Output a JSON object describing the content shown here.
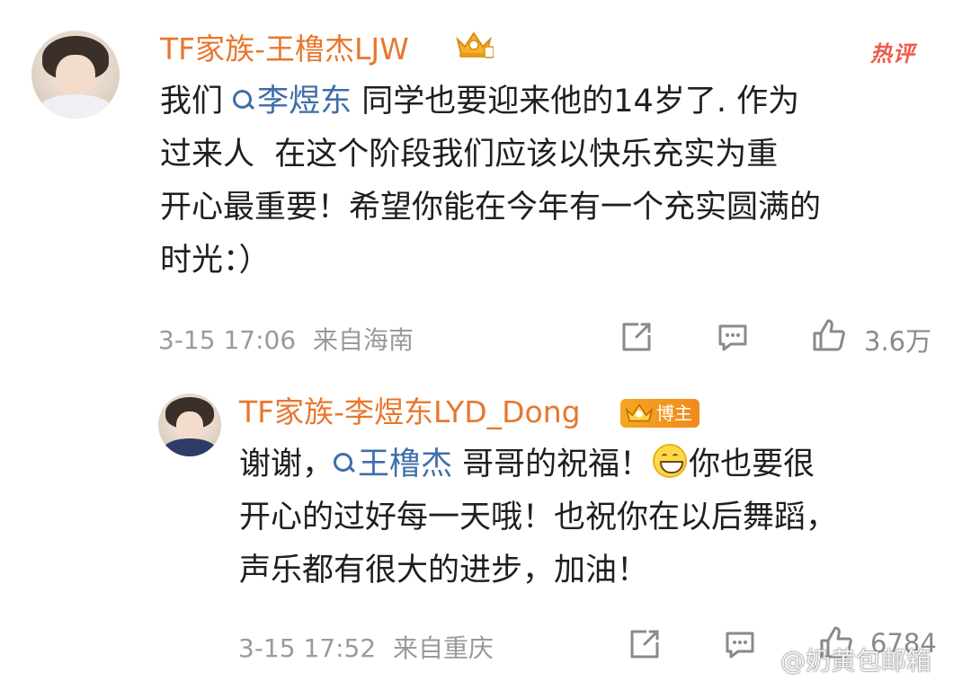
{
  "comment": {
    "username": "TF家族-王橹杰LJW",
    "hot_tag": "热评",
    "text_lines": [
      [
        "我们 ",
        "李煜东",
        " 同学也要迎来他的14岁了. 作为"
      ],
      "过来人  在这个阶段我们应该以快乐充实为重",
      "开心最重要！希望你能在今年有一个充实圆满的",
      "时光：）"
    ],
    "time": "3-15 17:06",
    "location": "来自海南",
    "likes": "3.6万"
  },
  "reply": {
    "username": "TF家族-李煜东LYD_Dong",
    "badge": "博主",
    "line1_before": "谢谢，",
    "mention": "王橹杰",
    "line1_after_mention": " 哥哥的祝福！",
    "line1_end": "你也要很",
    "line2": "开心的过好每一天哦！也祝你在以后舞蹈，",
    "line3": "声乐都有很大的进步，加油！",
    "time": "3-15 17:52",
    "location": "来自重庆",
    "likes": "6784"
  },
  "watermark": "@奶黄包邮箱",
  "colors": {
    "username": "#e8772e",
    "mention": "#3f6ea8",
    "meta": "#9a9a9a",
    "hot_tag": "#f05a4a"
  },
  "icons": [
    "share-icon",
    "comment-icon",
    "like-icon",
    "crown-icon",
    "emoji-grin-icon"
  ]
}
